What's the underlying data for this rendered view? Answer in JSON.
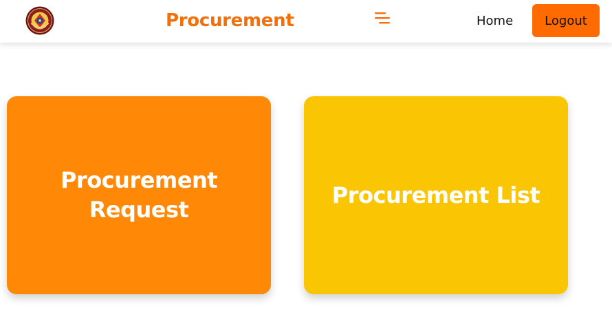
{
  "header": {
    "logo_icon": "university-seal-logo-icon",
    "title": "Procurement",
    "menu_icon": "hamburger-menu-icon",
    "home_label": "Home",
    "logout_label": "Logout"
  },
  "cards": [
    {
      "label": "Procurement Request"
    },
    {
      "label": "Procurement List"
    }
  ],
  "colors": {
    "title": "#f26f0a",
    "menu_icon": "#f26f0a",
    "logout_button": "#ff6b00",
    "request_card": "#ff8806",
    "list_card": "#fac503",
    "card_text": "#ffffff"
  }
}
